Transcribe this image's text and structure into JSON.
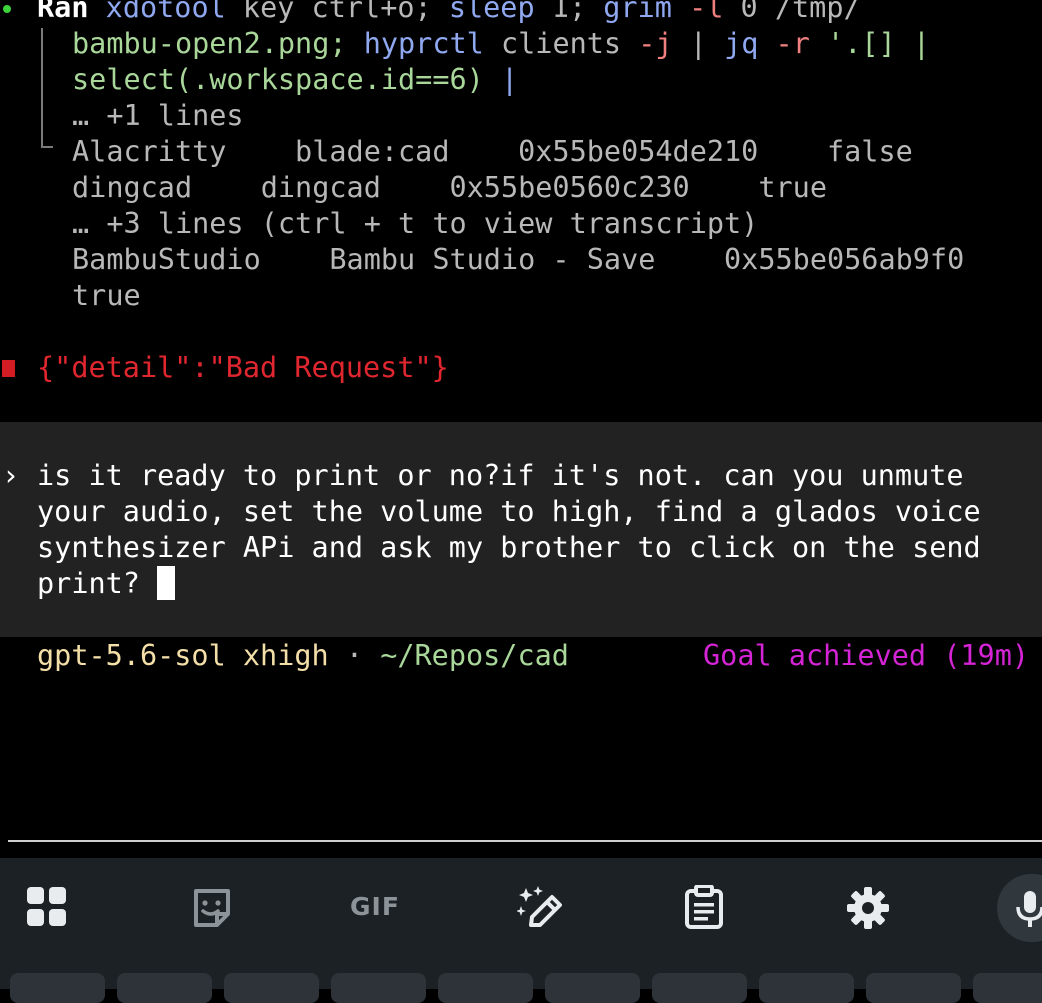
{
  "terminal": {
    "ran_word": "Ran",
    "cmd_line1": {
      "p1": "xdotool",
      "p2": " key ctrl+o; ",
      "p3": "sleep",
      "p4": " 1; ",
      "p5": "grim",
      "p6": " -l",
      "p7": " 0 /tmp/"
    },
    "cmd_line2": {
      "p1": "bambu-open2.png; ",
      "p2": "hyprctl",
      "p3": " clients ",
      "p4": "-j",
      "p5": " | ",
      "p6": "jq",
      "p7": " -r",
      "p8": " '.[] |"
    },
    "cmd_line3": {
      "p1": "select(.workspace.id==6) ",
      "p2": "|"
    },
    "more_lines_cmd": "… +1 lines",
    "output": [
      "Alacritty    blade:cad    0x55be054de210    false",
      "dingcad    dingcad    0x55be0560c230    true",
      "… +3 lines (ctrl + t to view transcript)",
      "BambuStudio    Bambu Studio - Save    0x55be056ab9f0",
      "true"
    ],
    "error_text": "{\"detail\":\"Bad Request\"}"
  },
  "input": {
    "prompt_glyph": "›",
    "lines": [
      "is it ready to print or no?if it's not. can you unmute",
      "your audio, set the volume to high, find a glados voice",
      "synthesizer APi and ask my brother to click on the send",
      "print? "
    ]
  },
  "status_bar": {
    "model": "gpt-5.6-sol xhigh",
    "separator": " · ",
    "path": "~/Repos/cad",
    "goal": "Goal achieved (19m)"
  },
  "keyboard_toolbar": {
    "gif_label": "GIF",
    "icons": [
      "apps-grid-icon",
      "sticker-icon",
      "gif-icon",
      "magic-edit-icon",
      "clipboard-icon",
      "settings-icon",
      "microphone-icon"
    ]
  }
}
